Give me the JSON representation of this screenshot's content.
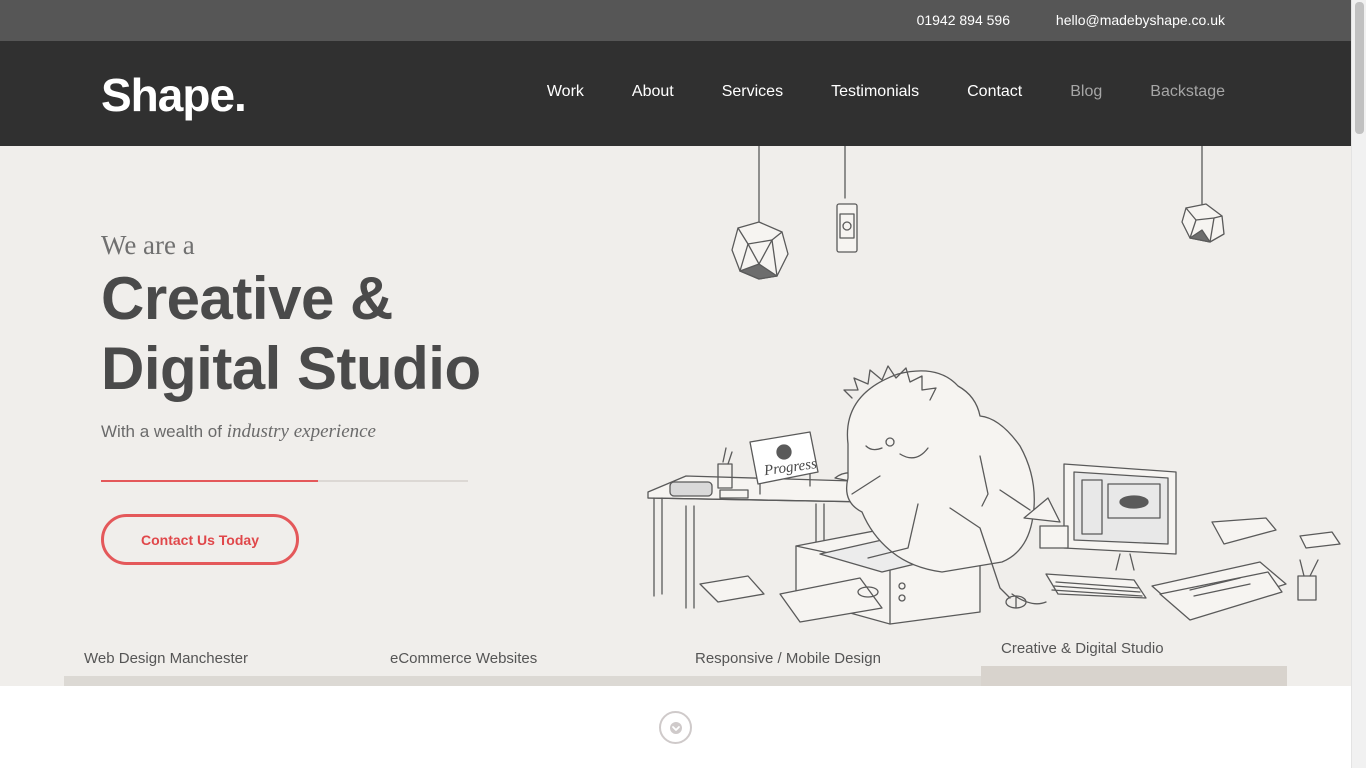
{
  "topbar": {
    "phone": "01942 894 596",
    "email": "hello@madebyshape.co.uk"
  },
  "header": {
    "logo": "Shape.",
    "nav": [
      {
        "label": "Work"
      },
      {
        "label": "About"
      },
      {
        "label": "Services"
      },
      {
        "label": "Testimonials"
      },
      {
        "label": "Contact"
      },
      {
        "label": "Blog"
      },
      {
        "label": "Backstage"
      }
    ]
  },
  "hero": {
    "intro": "We are a",
    "headline_line1": "Creative &",
    "headline_line2": "Digital Studio",
    "subline_prefix": "With a wealth of",
    "subline_emphasis": "industry experience",
    "progress_fraction": 0.59,
    "cta_label": "Contact Us Today",
    "illustration_sign": "Progress"
  },
  "tabs": [
    {
      "label": "Web Design Manchester"
    },
    {
      "label": "eCommerce Websites"
    },
    {
      "label": "Responsive / Mobile Design"
    },
    {
      "label": "Creative & Digital Studio",
      "active": true
    }
  ],
  "colors": {
    "accent": "#e4585a",
    "topbar": "#565656",
    "header": "#303030",
    "hero_bg": "#f0eeeb"
  },
  "icons": {
    "scroll_down": "chevron-down-icon"
  }
}
